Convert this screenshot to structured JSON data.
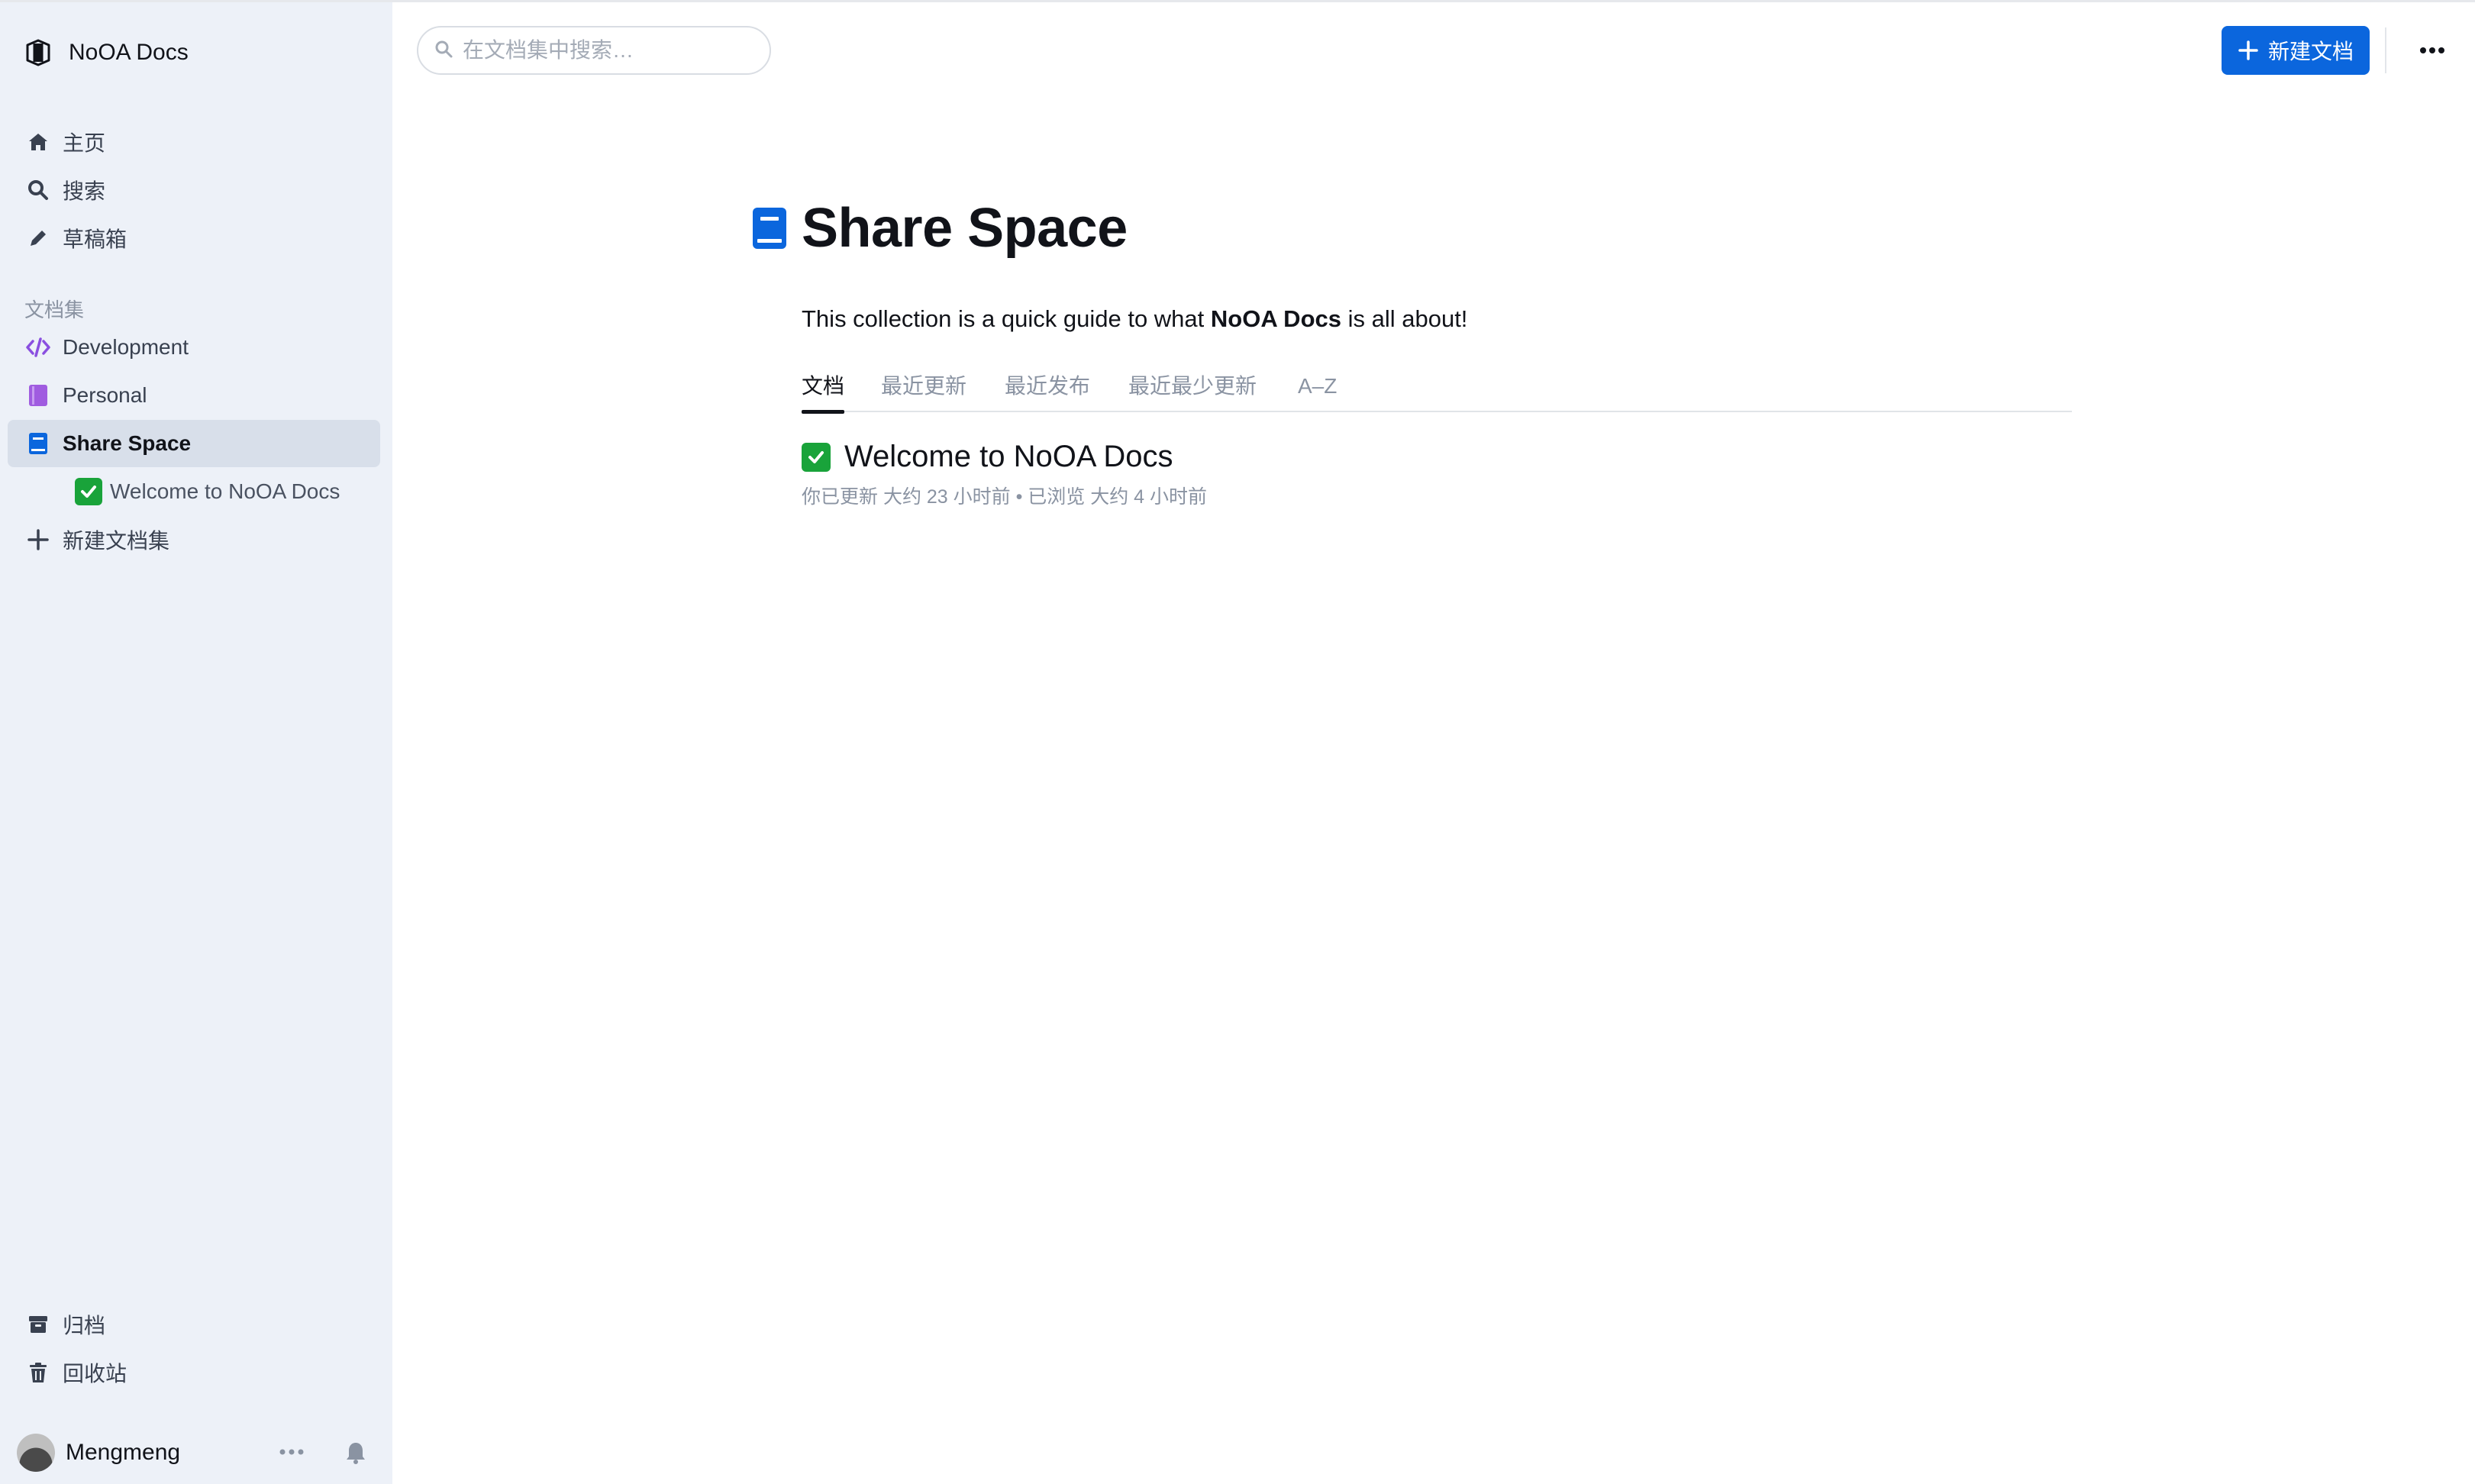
{
  "app": {
    "name": "NoOA Docs"
  },
  "sidebar": {
    "nav": [
      {
        "label": "主页",
        "icon": "home-icon"
      },
      {
        "label": "搜索",
        "icon": "search-icon"
      },
      {
        "label": "草稿箱",
        "icon": "pencil-icon"
      }
    ],
    "section_label": "文档集",
    "collections": [
      {
        "label": "Development",
        "icon": "code-icon",
        "color": "#8a4fe0"
      },
      {
        "label": "Personal",
        "icon": "book-icon",
        "color": "#a05ce0"
      },
      {
        "label": "Share Space",
        "icon": "book-icon",
        "color": "#0b66dd",
        "active": true
      }
    ],
    "child_doc": {
      "label": "Welcome to NoOA Docs",
      "emoji": "✅"
    },
    "new_collection": "新建文档集",
    "bottom": [
      {
        "label": "归档",
        "icon": "archive-icon"
      },
      {
        "label": "回收站",
        "icon": "trash-icon"
      }
    ],
    "user": {
      "name": "Mengmeng"
    }
  },
  "header": {
    "search_placeholder": "在文档集中搜索…",
    "new_doc_label": "新建文档"
  },
  "main": {
    "title": "Share Space",
    "description_prefix": "This collection is a quick guide to what ",
    "description_bold": "NoOA Docs",
    "description_suffix": " is all about!",
    "tabs": [
      "文档",
      "最近更新",
      "最近发布",
      "最近最少更新",
      "A–Z"
    ],
    "documents": [
      {
        "title": "Welcome to NoOA Docs",
        "emoji": "✅",
        "meta": "你已更新 大约 23 小时前 • 已浏览 大约 4 小时前"
      }
    ]
  },
  "colors": {
    "accent": "#0b66dd",
    "sidebar_bg": "#edf1f8",
    "active_bg": "#d8dfea"
  }
}
